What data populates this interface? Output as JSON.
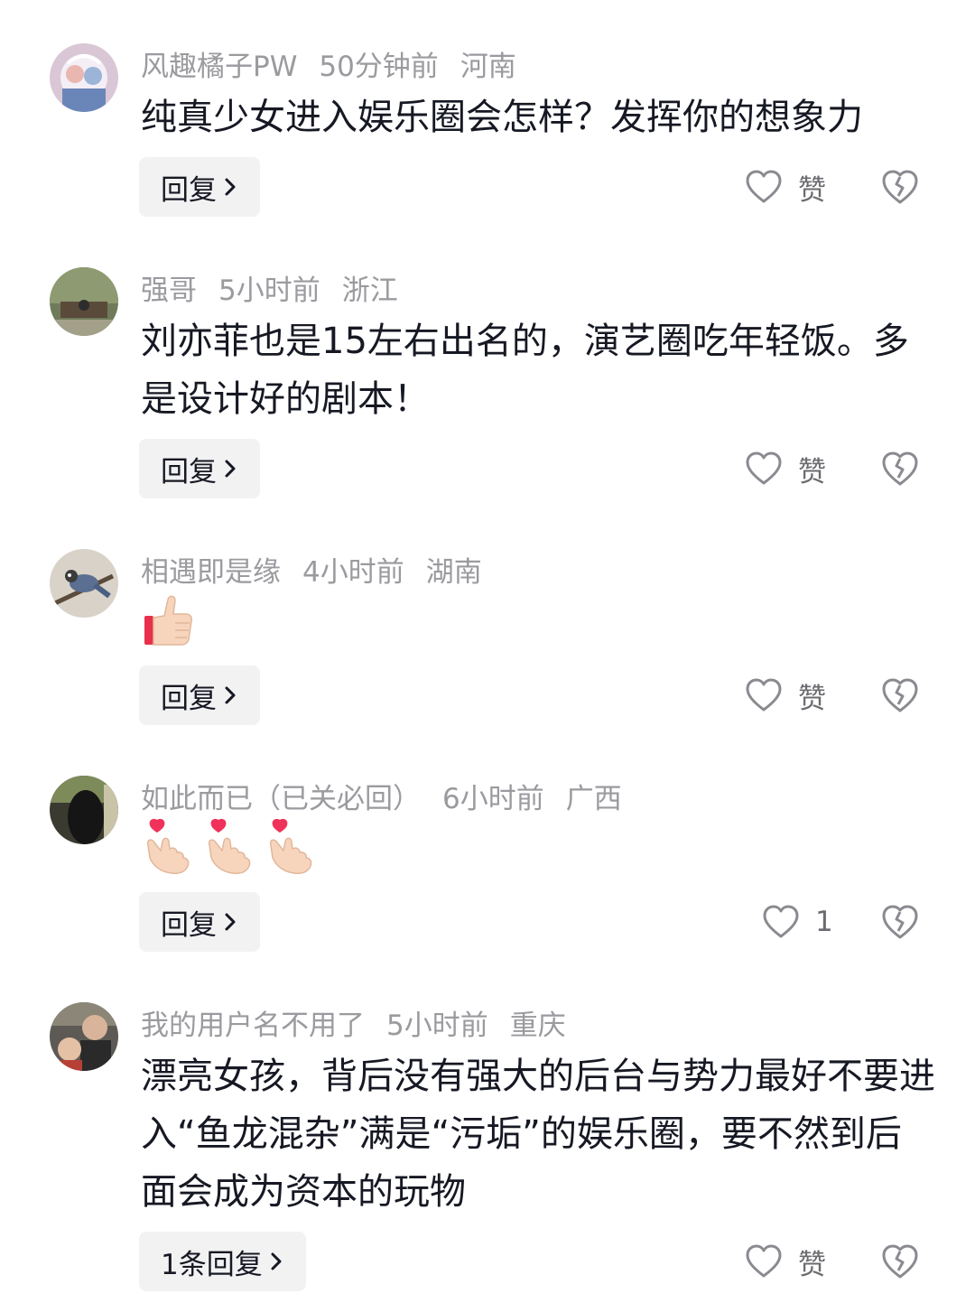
{
  "comments": [
    {
      "user": "风趣橘子PW",
      "time": "50分钟前",
      "location": "河南",
      "text": "纯真少女进入娱乐圈会怎样？发挥你的想象力",
      "reply_label": "回复",
      "like_label": "赞"
    },
    {
      "user": "强哥",
      "time": "5小时前",
      "location": "浙江",
      "text": "刘亦菲也是15左右出名的，演艺圈吃年轻饭。多是设计好的剧本！",
      "reply_label": "回复",
      "like_label": "赞"
    },
    {
      "user": "相遇即是缘",
      "time": "4小时前",
      "location": "湖南",
      "emoji": [
        "thumbs-up"
      ],
      "reply_label": "回复",
      "like_label": "赞"
    },
    {
      "user": "如此而已（已关必回）",
      "time": "6小时前",
      "location": "广西",
      "emoji": [
        "finger-heart",
        "finger-heart",
        "finger-heart"
      ],
      "reply_label": "回复",
      "like_label": "1"
    },
    {
      "user": "我的用户名不用了",
      "time": "5小时前",
      "location": "重庆",
      "text": "漂亮女孩，背后没有强大的后台与势力最好不要进入“鱼龙混杂”满是“污垢”的娱乐圈，要不然到后面会成为资本的玩物",
      "reply_label": "1条回复",
      "like_label": "赞"
    }
  ],
  "icons": {
    "like": "heart-outline-icon",
    "dislike": "broken-heart-icon",
    "reply_arrow": "chevron-right-icon"
  },
  "colors": {
    "meta_text": "#9a9a9f",
    "body_text": "#161823",
    "reply_bg": "#f2f2f3"
  }
}
